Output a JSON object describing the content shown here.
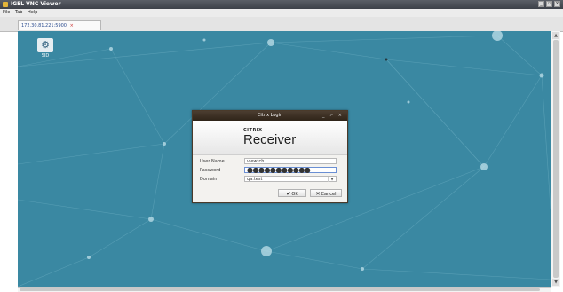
{
  "window": {
    "title": "IGEL VNC Viewer",
    "controls": [
      "_",
      "▫",
      "×"
    ]
  },
  "menu": [
    "File",
    "Tab",
    "Help"
  ],
  "tab": {
    "label": "172.30.81.221:5900",
    "close": "×"
  },
  "desktop": {
    "icon_label": "SID",
    "background": "#3a88a2"
  },
  "dialog": {
    "title": "Citrix Login",
    "controls": "_ ↗ ×",
    "brand_small": "CITRIX",
    "brand_large": "Receiver",
    "username_label": "User Name",
    "username_value": "viewtch",
    "password_label": "Password",
    "password_value": "●●●●●●●●●●●",
    "domain_label": "Domain",
    "domain_value": "qa.test",
    "ok_label": "OK",
    "cancel_label": "Cancel"
  }
}
